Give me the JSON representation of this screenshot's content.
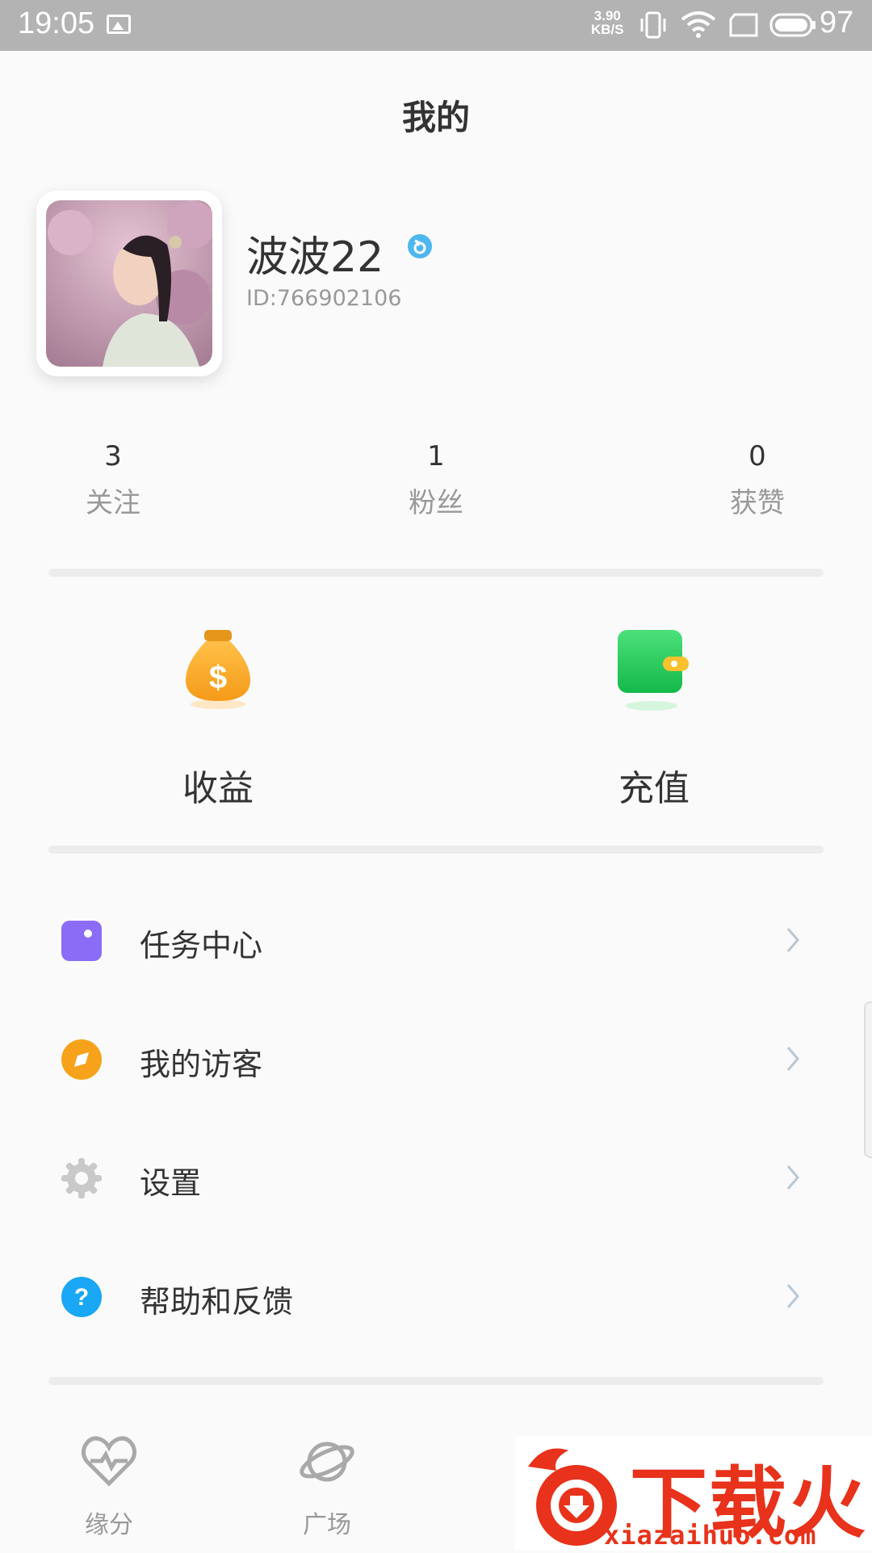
{
  "status_bar": {
    "time": "19:05",
    "speed_value": "3.90",
    "speed_unit": "KB/S",
    "battery": "97"
  },
  "page_title": "我的",
  "profile": {
    "username": "波波22",
    "user_id": "ID:766902106"
  },
  "stats": [
    {
      "value": "3",
      "label": "关注"
    },
    {
      "value": "1",
      "label": "粉丝"
    },
    {
      "value": "0",
      "label": "获赞"
    }
  ],
  "wallet": {
    "earnings_label": "收益",
    "recharge_label": "充值"
  },
  "menu": [
    {
      "label": "任务中心",
      "icon": "task-icon",
      "color": "#8b6cf6"
    },
    {
      "label": "我的访客",
      "icon": "visitor-icon",
      "color": "#f7a21b"
    },
    {
      "label": "设置",
      "icon": "gear-icon",
      "color": "#c9c9c9"
    },
    {
      "label": "帮助和反馈",
      "icon": "help-icon",
      "color": "#1aa7f5"
    }
  ],
  "tabbar": [
    {
      "label": "缘分",
      "icon": "heartbeat-icon"
    },
    {
      "label": "广场",
      "icon": "planet-icon"
    }
  ],
  "watermark": {
    "text": "下载火",
    "url": "xiazaihuo.com"
  },
  "colors": {
    "accent_blue": "#4fb7f0",
    "chevron": "#b9c8d6",
    "watermark_red": "#e8321b"
  }
}
